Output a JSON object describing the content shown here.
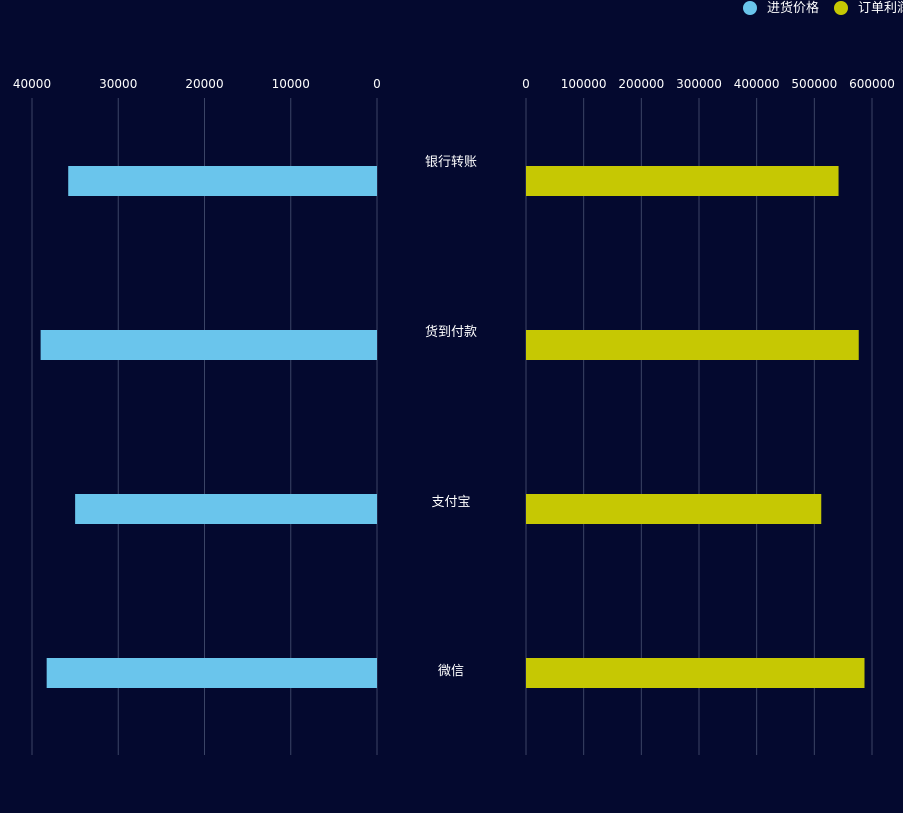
{
  "chart_data": {
    "type": "bar",
    "orientation": "horizontal-butterfly",
    "categories": [
      "银行转账",
      "货到付款",
      "支付宝",
      "微信"
    ],
    "series": [
      {
        "name": "进货价格",
        "side": "left",
        "color": "#6ac5ec",
        "values": [
          35800,
          39000,
          35000,
          38300
        ],
        "axis": {
          "ticks": [
            40000,
            30000,
            20000,
            10000,
            0
          ],
          "range": [
            0,
            40000
          ]
        }
      },
      {
        "name": "订单利润",
        "side": "right",
        "color": "#c6c803",
        "values": [
          542000,
          577000,
          512000,
          587000
        ],
        "axis": {
          "ticks": [
            0,
            100000,
            200000,
            300000,
            400000,
            500000,
            600000
          ],
          "range": [
            0,
            600000
          ]
        }
      }
    ],
    "grid": true,
    "legend_position": "top-right"
  },
  "colors": {
    "background": "#04092f",
    "grid": "#3b4466",
    "text": "#ffffff"
  }
}
